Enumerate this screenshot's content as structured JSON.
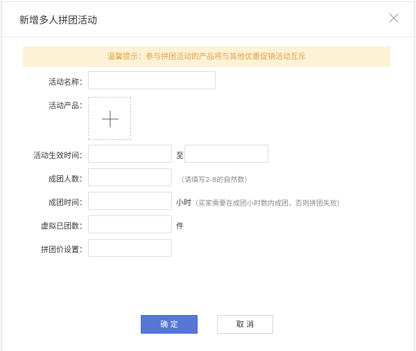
{
  "dialog": {
    "title": "新增多人拼团活动",
    "close_icon": "close-icon",
    "notice": "温馨提示：参与拼团活动的产品将与其他优惠促销活动互斥"
  },
  "form": {
    "name_label": "活动名称：",
    "name_value": "",
    "product_label": "活动产品：",
    "upload_icon": "plus-icon",
    "time_label": "活动生效时间：",
    "time_start": "",
    "time_to": "至",
    "time_end": "",
    "people_label": "成团人数：",
    "people_value": "",
    "people_hint": "（请填写2-8的自然数）",
    "duration_label": "成团时间：",
    "duration_value": "",
    "duration_unit": "小时",
    "duration_hint": "（买家需要在成团小时数内成团，否则拼团失败）",
    "virtual_label": "虚拟已团数：",
    "virtual_value": "",
    "virtual_unit": "件",
    "price_label": "拼团价设置：",
    "price_value": ""
  },
  "footer": {
    "confirm_label": "确 定",
    "cancel_label": "取 消"
  },
  "colors": {
    "primary": "#5676d8",
    "notice_bg": "#fdf2d6",
    "notice_text": "#e0a24a"
  }
}
